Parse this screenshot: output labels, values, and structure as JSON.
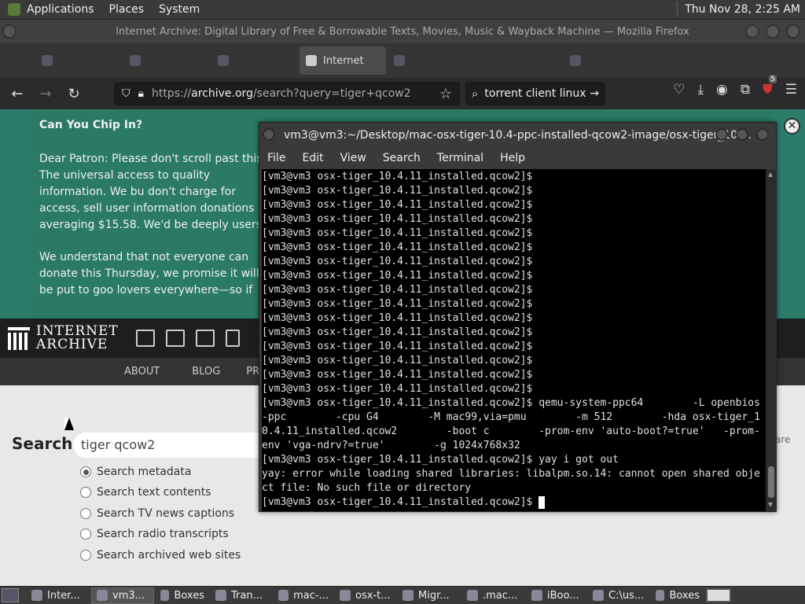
{
  "topbar": {
    "menus": [
      "Applications",
      "Places",
      "System"
    ],
    "clock": "Thu Nov 28,  2:25 AM"
  },
  "firefox": {
    "window_title": "Internet Archive: Digital Library of Free & Borrowable Texts, Movies, Music & Wayback Machine — Mozilla Firefox",
    "tabs": [
      {
        "label": "Internet",
        "active": true
      }
    ],
    "url": {
      "prefix": "https://",
      "host": "archive.org",
      "path": "/search?query=tiger+qcow2"
    },
    "search_box": "torrent client linux",
    "badge_count": "5"
  },
  "page": {
    "banner": {
      "heading": "Can You Chip In?",
      "p1": "Dear Patron: Please don't scroll past this. The universal access to quality information. We bu don't charge for access, sell user information donations averaging $15.58. We'd be deeply users that support us financially.",
      "p2": "We understand that not everyone can donate this Thursday, we promise it will be put to goo lovers everywhere—so if you find all these bit"
    },
    "ia_logo": {
      "line1": "INTERNET",
      "line2": "ARCHIVE"
    },
    "nav_links": [
      "ABOUT",
      "BLOG",
      "PROJ"
    ],
    "search": {
      "label": "Search",
      "query": "tiger qcow2",
      "options": [
        {
          "label": "Search metadata",
          "selected": true
        },
        {
          "label": "Search text contents",
          "selected": false
        },
        {
          "label": "Search TV news captions",
          "selected": false
        },
        {
          "label": "Search radio transcripts",
          "selected": false
        },
        {
          "label": "Search archived web sites",
          "selected": false
        }
      ],
      "right_fragment": "are"
    }
  },
  "terminal": {
    "title": "vm3@vm3:~/Desktop/mac-osx-tiger-10.4-ppc-installed-qcow2-image/osx-tiger_10....",
    "menu": [
      "File",
      "Edit",
      "View",
      "Search",
      "Terminal",
      "Help"
    ],
    "prompt": "[vm3@vm3 osx-tiger_10.4.11_installed.qcow2]$",
    "empty_prompt_count": 16,
    "qemu_command": "qemu-system-ppc64        -L openbios-ppc        -cpu G4        -M mac99,via=pmu        -m 512        -hda osx-tiger_10.4.11_installed.qcow2        -boot c        -prom-env 'auto-boot?=true'   -prom-env 'vga-ndrv?=true'        -g 1024x768x32",
    "yay_command": "yay i got out",
    "error": "yay: error while loading shared libraries: libalpm.so.14: cannot open shared object file: No such file or directory"
  },
  "taskbar": {
    "items": [
      {
        "label": "Inter...",
        "active": false
      },
      {
        "label": "vm3...",
        "active": true
      },
      {
        "label": "Boxes",
        "active": false
      },
      {
        "label": "Tran...",
        "active": false
      },
      {
        "label": "mac-...",
        "active": false
      },
      {
        "label": "osx-t...",
        "active": false
      },
      {
        "label": "Migr...",
        "active": false
      },
      {
        "label": ".mac...",
        "active": false
      },
      {
        "label": "iBoo...",
        "active": false
      },
      {
        "label": "C:\\us...",
        "active": false
      },
      {
        "label": "Boxes",
        "active": false
      }
    ]
  }
}
